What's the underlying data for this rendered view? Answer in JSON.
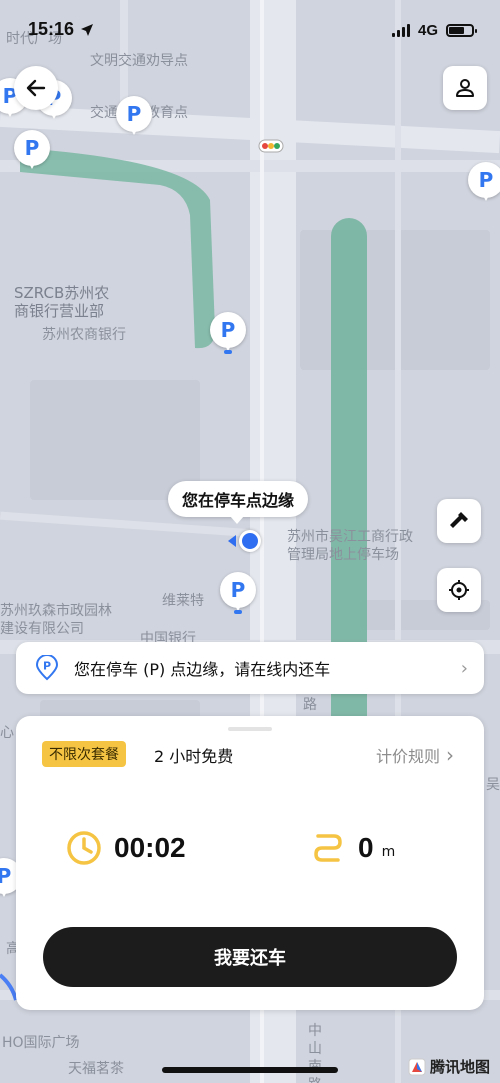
{
  "status_bar": {
    "time": "15:16",
    "network": "4G"
  },
  "map": {
    "labels": [
      {
        "text": "时代广场"
      },
      {
        "text": "文明交通劝导点"
      },
      {
        "text": "交通安全教育点"
      },
      {
        "text": "SZRCB苏州农"
      },
      {
        "text": "商银行营业部"
      },
      {
        "text": "苏州农商银行"
      },
      {
        "text": "苏州市吴江工商行政"
      },
      {
        "text": "管理局地上停车场"
      },
      {
        "text": "苏州玖森市政园林"
      },
      {
        "text": "建设有限公司"
      },
      {
        "text": "维莱特"
      },
      {
        "text": "中国银行"
      },
      {
        "text": "路"
      },
      {
        "text": "吴江"
      },
      {
        "text": "心"
      },
      {
        "text": "高"
      },
      {
        "text": "HO国际广场"
      },
      {
        "text": "天福茗茶"
      },
      {
        "text": "中山南路"
      }
    ],
    "bubble_text": "您在停车点边缘",
    "parking_glyph": "P",
    "provider": "腾讯地图"
  },
  "notice": {
    "text": "您在停车 (P) 点边缘，请在线内还车",
    "chevron": "›"
  },
  "sheet": {
    "plan_tag": "不限次套餐",
    "plan_desc": "2 小时免费",
    "pricing_link": "计价规则",
    "pricing_chevron": "›",
    "duration": "00:02",
    "distance": "0",
    "distance_unit": "m",
    "return_button": "我要还车"
  },
  "colors": {
    "accent_yellow": "#f5c443",
    "pin_blue": "#3377f0",
    "button_dark": "#1c1c1c",
    "park_green": "#6fb29c"
  }
}
